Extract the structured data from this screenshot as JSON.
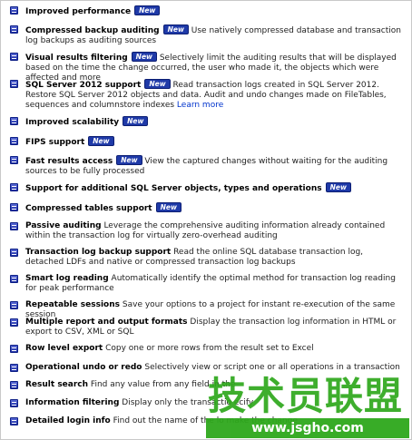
{
  "features": [
    {
      "title": "Improved performance",
      "new": true,
      "desc": ""
    },
    {
      "title": "Compressed backup auditing",
      "new": true,
      "desc": "Use natively compressed database and transaction log backups as auditing sources"
    },
    {
      "title": "Visual results filtering",
      "new": true,
      "desc": "Selectively limit the auditing results that will be displayed based on the time the change occurred, the user who made it, the objects which were affected and more"
    },
    {
      "title": "SQL Server 2012 support",
      "new": true,
      "desc": "Read transaction logs created in SQL Server 2012. Restore SQL Server 2012 objects and data. Audit and undo changes made on FileTables, sequences and columnstore indexes",
      "link": "Learn more"
    },
    {
      "title": "Improved scalability",
      "new": true,
      "desc": ""
    },
    {
      "title": "FIPS support",
      "new": true,
      "desc": ""
    },
    {
      "title": "Fast results access",
      "new": true,
      "desc": "View the captured changes without waiting for the auditing sources to be fully processed"
    },
    {
      "title": "Support for additional SQL Server objects, types and operations",
      "new": true,
      "desc": ""
    },
    {
      "title": "Compressed tables support",
      "new": true,
      "desc": ""
    },
    {
      "title": "Passive auditing",
      "new": false,
      "desc": "Leverage the comprehensive auditing information already contained within the transaction log for virtually zero-overhead auditing"
    },
    {
      "title": "Transaction log backup support",
      "new": false,
      "desc": "Read the online SQL database transaction log, detached LDFs and native or compressed transaction log backups"
    },
    {
      "title": "Smart log reading",
      "new": false,
      "desc": "Automatically identify the optimal method for transaction log reading for peak performance"
    },
    {
      "title": "Repeatable sessions",
      "new": false,
      "desc": "Save your options to a project for instant re-execution of the same session"
    },
    {
      "title": "Multiple report and output formats",
      "new": false,
      "desc": "Display the transaction log information in HTML or export to CSV, XML or SQL"
    },
    {
      "title": "Row level export",
      "new": false,
      "desc": "Copy one or more rows from the result set to Excel"
    },
    {
      "title": "Operational undo or redo",
      "new": false,
      "desc": "Selectively view or script one or all operations in a transaction"
    },
    {
      "title": "Result search",
      "new": false,
      "desc": "Find any value from any field in the"
    },
    {
      "title": "Information filtering",
      "new": false,
      "desc": "Display only the transactio                                   ecify"
    },
    {
      "title": "Detailed login info",
      "new": false,
      "desc": "Find out the name of the lo                                   make the change"
    }
  ],
  "badge_label": "New",
  "watermark": {
    "chinese": "技术员联盟",
    "url": "www.jsgho.com"
  },
  "colors": {
    "bullet": "#1c2ea3",
    "badge": "#1f3aa8",
    "link": "#0033cc",
    "watermark": "#2ea81c"
  },
  "icons": {
    "bullet": "bullet-icon"
  }
}
